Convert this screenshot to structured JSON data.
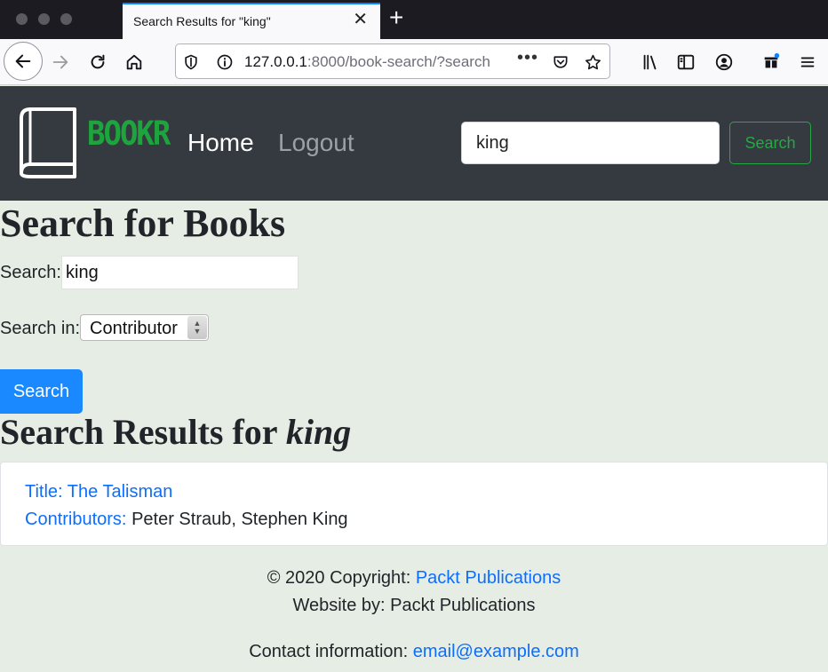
{
  "browser": {
    "tab_title": "Search Results for \"king\"",
    "url_host": "127.0.0.1",
    "url_rest": ":8000/book-search/?search"
  },
  "navbar": {
    "brand": "BOOKR",
    "home": "Home",
    "logout": "Logout",
    "search_value": "king",
    "search_button": "Search"
  },
  "main": {
    "title": "Search for Books",
    "search_label": "Search:",
    "search_value": "king",
    "search_in_label": "Search in:",
    "search_in_selected": "Contributor",
    "submit_label": "Search",
    "results_heading_prefix": "Search Results for ",
    "results_heading_term": "king",
    "results": [
      {
        "title": "Title: The Talisman",
        "contributors_label": "Contributors:",
        "contributors": "Peter Straub, Stephen King"
      }
    ]
  },
  "footer": {
    "copyright_prefix": "© 2020 Copyright: ",
    "copyright_link": "Packt Publications",
    "website_by": "Website by: Packt Publications",
    "contact_prefix": "Contact information: ",
    "contact_email": "email@example.com"
  },
  "colors": {
    "page_bg": "#e5ede5",
    "navbar_bg": "#343a40",
    "brand_green": "#1ea43d",
    "link_blue": "#0d6efd",
    "primary_button": "#1a89ff"
  },
  "icons": [
    "back-icon",
    "forward-icon",
    "reload-icon",
    "home-icon",
    "tracking-shield-icon",
    "info-icon",
    "pocket-icon",
    "star-icon",
    "library-icon",
    "sidebar-icon",
    "account-icon",
    "extensions-icon",
    "menu-icon",
    "book-logo-icon"
  ]
}
